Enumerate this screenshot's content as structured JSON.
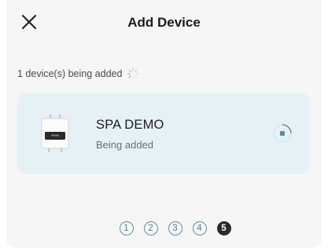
{
  "header": {
    "title": "Add Device",
    "close_icon": "close-icon"
  },
  "status": {
    "text": "1 device(s) being added",
    "spinner_icon": "loading-spinner-icon"
  },
  "device": {
    "name": "SPA DEMO",
    "state": "Being added",
    "thumbnail": "device-thumbnail",
    "progress_icon": "progress-ring-icon"
  },
  "steps": {
    "items": [
      "1",
      "2",
      "3",
      "4",
      "5"
    ],
    "active": "5"
  },
  "colors": {
    "card_background": "#e6f1f5",
    "accent": "#5d8f9e",
    "active_step": "#2b2b2b"
  }
}
